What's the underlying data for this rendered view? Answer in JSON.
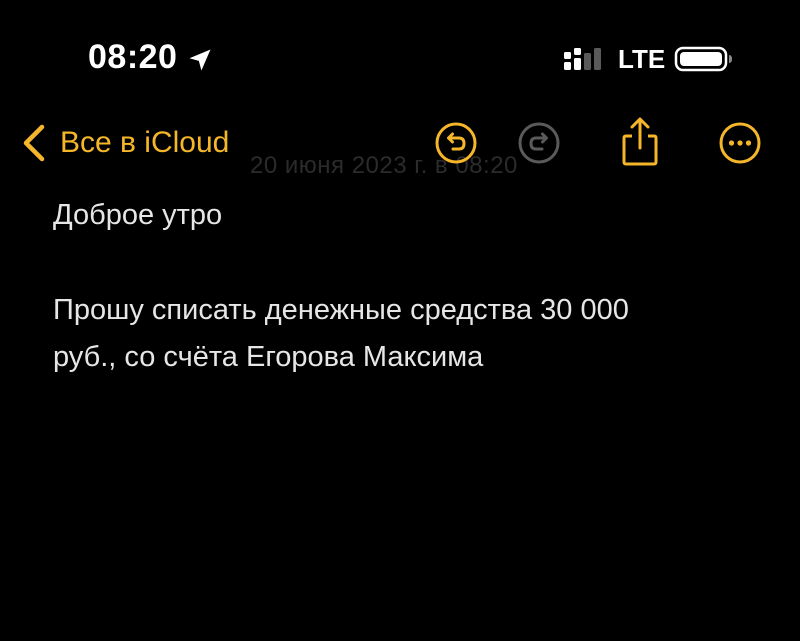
{
  "status_bar": {
    "time": "08:20",
    "network": "LTE",
    "icons": [
      "location-arrow-icon",
      "cellular-signal-icon",
      "battery-icon"
    ]
  },
  "nav_bar": {
    "back_label": "Все в iCloud",
    "date_text": "20 июня 2023 г. в 08:20",
    "icons": [
      "chevron-left-icon",
      "undo-icon",
      "redo-icon",
      "share-icon",
      "more-icon"
    ]
  },
  "note": {
    "line1": "Доброе утро",
    "line2": "Прошу списать денежные средства 30 000",
    "line3": "руб., со счёта Егорова Максима"
  },
  "colors": {
    "accent": "#f5b62a",
    "background": "#000000",
    "text": "#e6e6e6",
    "disabled_icon": "#5a5a5a"
  }
}
